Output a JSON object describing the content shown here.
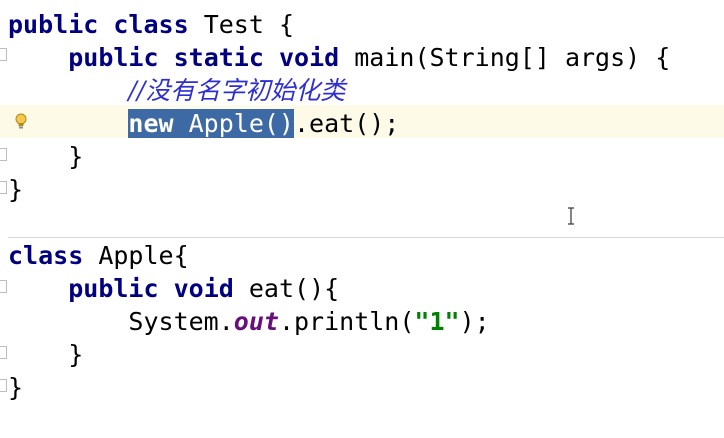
{
  "code": {
    "l1": {
      "kw1": "public",
      "kw2": "class",
      "rest": " Test {"
    },
    "l2": {
      "indent": "    ",
      "kw1": "public",
      "kw2": "static",
      "kw3": "void",
      "rest": " main(String[] args) {"
    },
    "l3": {
      "indent": "        ",
      "comment": "//没有名字初始化类"
    },
    "l4": {
      "indent": "        ",
      "selected_kw": "new",
      "selected_rest": " Apple()",
      "rest": ".eat();"
    },
    "l5": {
      "text": "    }"
    },
    "l6": {
      "text": "}"
    },
    "l7": {
      "kw": "class",
      "rest": " Apple{"
    },
    "l8": {
      "indent": "    ",
      "kw": "public",
      "rest_kw": "void",
      "rest": " eat(){"
    },
    "l9": {
      "indent": "        ",
      "pre": "System.",
      "field": "out",
      "mid": ".println(",
      "str": "\"1\"",
      "post": ");"
    },
    "l10": {
      "text": "    }"
    },
    "l11": {
      "text": "}"
    }
  },
  "icons": {
    "intention": "lightbulb-icon",
    "cursor": "text-cursor-icon"
  },
  "colors": {
    "keyword": "#000080",
    "comment": "#2f2fd0",
    "selection": "#3d6aa5",
    "string": "#008000",
    "field": "#660e7a",
    "caret_row": "#fdfbe8"
  }
}
